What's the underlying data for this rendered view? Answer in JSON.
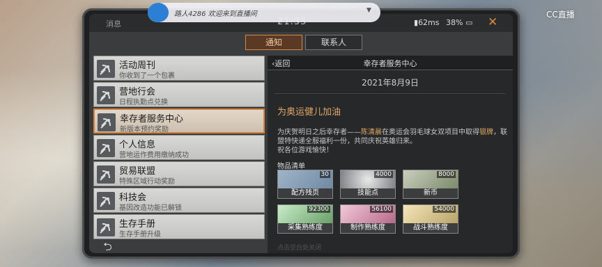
{
  "status": {
    "panel_label": "消息",
    "time": "21:35",
    "signal": "62ms",
    "battery": "38%"
  },
  "overlay": {
    "user_text": "路人4286 欢迎来到直播间"
  },
  "watermark": "CC直播",
  "tabs": [
    {
      "label": "通知",
      "active": true
    },
    {
      "label": "联系人",
      "active": false
    }
  ],
  "list": [
    {
      "title": "活动周刊",
      "sub": "你收到了一个包裹"
    },
    {
      "title": "营地行会",
      "sub": "日程执勤点兑换"
    },
    {
      "title": "幸存者服务中心",
      "sub": "新版本预约奖励",
      "selected": true
    },
    {
      "title": "个人信息",
      "sub": "营地运作费用缴纳成功"
    },
    {
      "title": "贸易联盟",
      "sub": "特殊区域行动奖励"
    },
    {
      "title": "科技会",
      "sub": "基因改造功能已解锁"
    },
    {
      "title": "生存手册",
      "sub": "生存手册升级"
    }
  ],
  "detail": {
    "back": "返回",
    "title": "幸存者服务中心",
    "date": "2021年8月9日",
    "heading": "为奥运健儿加油",
    "body_a": "为庆贺明日之后幸存者——",
    "body_name": "陈清晨",
    "body_b": "在奥运会羽毛球女双项目中取得",
    "body_medal": "银牌",
    "body_c": "，联盟特快递全服福利一份，共同庆祝英雄归来。",
    "body_d": "祝各位游戏愉快！",
    "items_title": "物品清单",
    "items": [
      {
        "name": "配方残页",
        "qty": "30",
        "color": "#6f8aa4"
      },
      {
        "name": "技能点",
        "qty": "4000",
        "color": "#9aa0a6"
      },
      {
        "name": "新币",
        "qty": "8000",
        "color": "#7c8a6a"
      },
      {
        "name": "采集熟练度",
        "qty": "92300",
        "color": "#6aa06a"
      },
      {
        "name": "制作熟练度",
        "qty": "56100",
        "color": "#b86a8a"
      },
      {
        "name": "战斗熟练度",
        "qty": "54000",
        "color": "#b8a36a"
      }
    ]
  },
  "footer_faint": "点击空白处关闭"
}
